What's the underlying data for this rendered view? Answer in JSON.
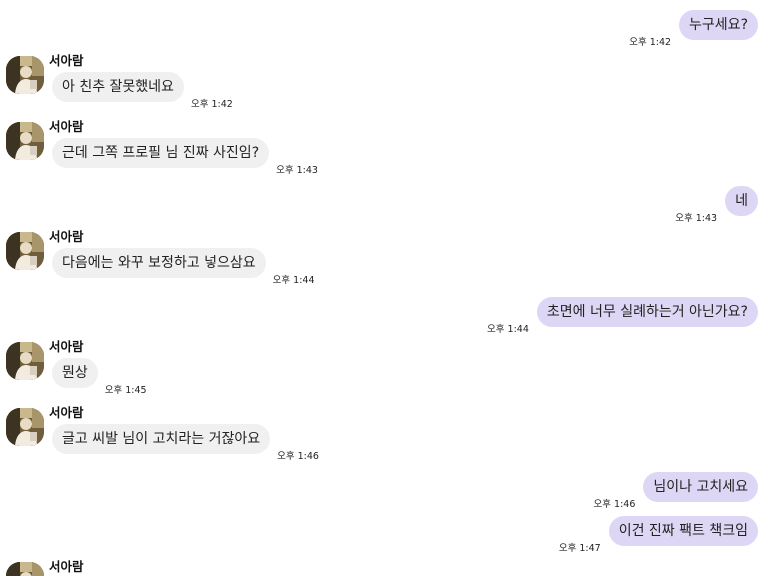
{
  "messages": [
    {
      "direction": "out",
      "text": "누구세요?",
      "time": "오후 1:42"
    },
    {
      "direction": "in",
      "sender": "서아람",
      "text": "아 친추 잘못했네요",
      "time": "오후 1:42"
    },
    {
      "direction": "in",
      "sender": "서아람",
      "text": "근데 그쪽 프로필 님 진짜 사진임?",
      "time": "오후 1:43"
    },
    {
      "direction": "out",
      "text": "네",
      "time": "오후 1:43"
    },
    {
      "direction": "in",
      "sender": "서아람",
      "text": "다음에는 와꾸 보정하고 넣으삼요",
      "time": "오후 1:44"
    },
    {
      "direction": "out",
      "text": "초면에 너무 실례하는거 아닌가요?",
      "time": "오후 1:44"
    },
    {
      "direction": "in",
      "sender": "서아람",
      "text": "뭔상",
      "time": "오후 1:45"
    },
    {
      "direction": "in",
      "sender": "서아람",
      "text": "글고 씨발 님이 고치라는 거잖아요",
      "time": "오후 1:46"
    },
    {
      "direction": "out",
      "text": "님이나 고치세요",
      "time": "오후 1:46"
    },
    {
      "direction": "out",
      "text": "이건 진짜 팩트 책크임",
      "time": "오후 1:47"
    },
    {
      "direction": "in",
      "sender": "서아람",
      "text": "",
      "time": ""
    }
  ]
}
